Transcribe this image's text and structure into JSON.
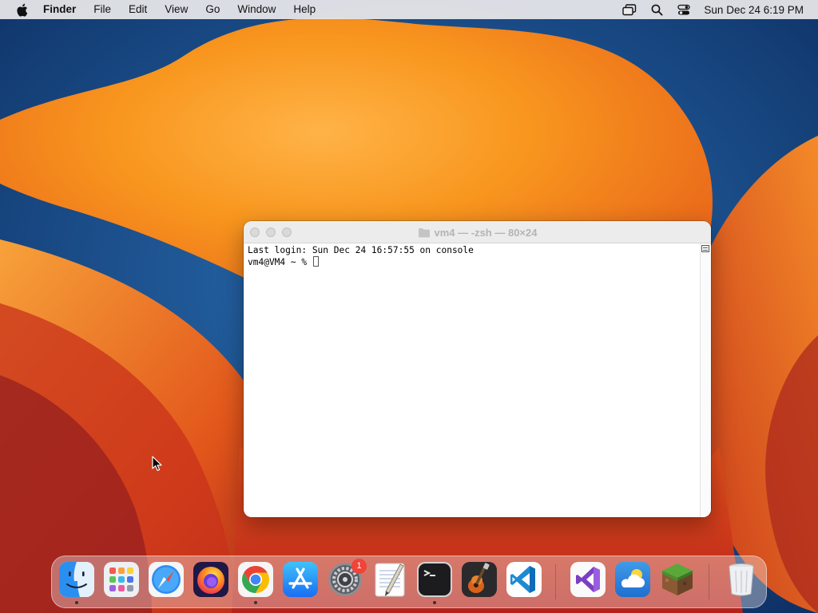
{
  "menubar": {
    "app_name": "Finder",
    "menus": [
      "File",
      "Edit",
      "View",
      "Go",
      "Window",
      "Help"
    ],
    "clock": "Sun Dec 24  6:19 PM",
    "status_icons": [
      "screen-mirroring-icon",
      "spotlight-search-icon",
      "control-center-icon"
    ]
  },
  "terminal": {
    "title": "vm4 — -zsh — 80×24",
    "lines": [
      "Last login: Sun Dec 24 16:57:55 on console",
      "vm4@VM4 ~ % "
    ]
  },
  "dock": {
    "apps": [
      {
        "name": "Finder",
        "icon": "finder-icon",
        "running": true
      },
      {
        "name": "Launchpad",
        "icon": "launchpad-icon",
        "running": false
      },
      {
        "name": "Safari",
        "icon": "safari-icon",
        "running": false
      },
      {
        "name": "Firefox",
        "icon": "firefox-icon",
        "running": false
      },
      {
        "name": "Google Chrome",
        "icon": "chrome-icon",
        "running": true
      },
      {
        "name": "App Store",
        "icon": "app-store-icon",
        "running": false
      },
      {
        "name": "System Settings",
        "icon": "system-settings-icon",
        "running": false,
        "badge": "1"
      },
      {
        "name": "TextEdit",
        "icon": "textedit-icon",
        "running": false
      },
      {
        "name": "Terminal",
        "icon": "terminal-icon",
        "running": true
      },
      {
        "name": "GarageBand",
        "icon": "garageband-icon",
        "running": false
      },
      {
        "name": "Visual Studio Code",
        "icon": "vscode-icon",
        "running": false
      },
      {
        "name": "Visual Studio",
        "icon": "visual-studio-icon",
        "running": false
      },
      {
        "name": "Weather",
        "icon": "weather-icon",
        "running": false
      },
      {
        "name": "Minecraft",
        "icon": "minecraft-icon",
        "running": false
      },
      {
        "name": "Trash",
        "icon": "trash-icon",
        "running": false
      }
    ]
  },
  "colors": {
    "wallpaper_orange": "#f7941d",
    "wallpaper_blue": "#1d4f8c",
    "badge_red": "#f0433a"
  }
}
